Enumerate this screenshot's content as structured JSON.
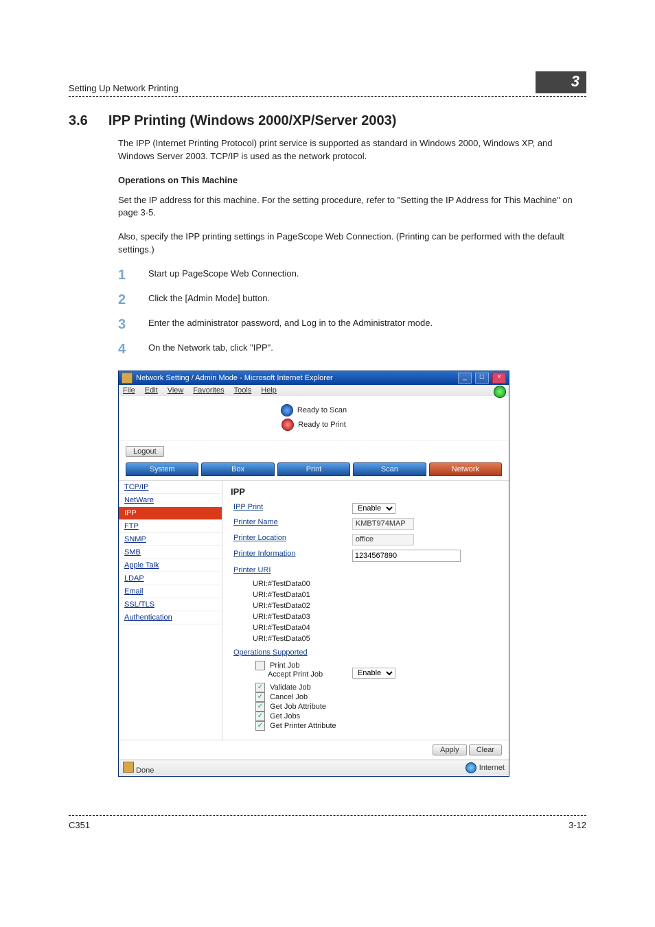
{
  "header": {
    "running_head": "Setting Up Network Printing",
    "chapter_badge": "3"
  },
  "section": {
    "number": "3.6",
    "title": "IPP Printing (Windows 2000/XP/Server 2003)"
  },
  "intro_para": "The IPP (Internet Printing Protocol) print service is supported as standard in Windows 2000, Windows XP, and Windows Server 2003. TCP/IP is used as the network protocol.",
  "subhead": "Operations on This Machine",
  "ops_para1": "Set the IP address for this machine. For the setting procedure, refer to \"Setting the IP Address for This Machine\" on page 3-5.",
  "ops_para2": "Also, specify the IPP printing settings in PageScope Web Connection. (Printing can be performed with the default settings.)",
  "steps": [
    "Start up PageScope Web Connection.",
    "Click the [Admin Mode] button.",
    "Enter the administrator password, and Log in to the Administrator mode.",
    "On the Network tab, click \"IPP\"."
  ],
  "browser": {
    "titlebar_text": "Network Setting / Admin Mode - Microsoft Internet Explorer",
    "menus": [
      "File",
      "Edit",
      "View",
      "Favorites",
      "Tools",
      "Help"
    ],
    "status_ready_scan": "Ready to Scan",
    "status_ready_print": "Ready to Print",
    "logout_btn": "Logout",
    "tabs": [
      "System",
      "Box",
      "Print",
      "Scan",
      "Network"
    ],
    "sidebar_items": [
      "TCP/IP",
      "NetWare",
      "IPP",
      "FTP",
      "SNMP",
      "SMB",
      "Apple Talk",
      "LDAP",
      "Email",
      "SSL/TLS",
      "Authentication"
    ],
    "panel": {
      "heading": "IPP",
      "ipp_print_label": "IPP Print",
      "ipp_print_value": "Enable",
      "printer_name_label": "Printer Name",
      "printer_name_value": "KMBT974MAP",
      "printer_location_label": "Printer Location",
      "printer_location_value": "office",
      "printer_information_label": "Printer Information",
      "printer_information_value": "1234567890",
      "printer_uri_label": "Printer URI",
      "uris": [
        "URI:#TestData00",
        "URI:#TestData01",
        "URI:#TestData02",
        "URI:#TestData03",
        "URI:#TestData04",
        "URI:#TestData05"
      ],
      "ops_supported_label": "Operations Supported",
      "ops": [
        {
          "label": "Print Job",
          "checked": false
        },
        {
          "label": "Accept Print Job",
          "checked": false,
          "right_label": "Enable"
        },
        {
          "label": "Validate Job",
          "checked": true
        },
        {
          "label": "Cancel Job",
          "checked": true
        },
        {
          "label": "Get Job Attribute",
          "checked": true
        },
        {
          "label": "Get Jobs",
          "checked": true
        },
        {
          "label": "Get Printer Attribute",
          "checked": true
        }
      ],
      "apply_btn": "Apply",
      "clear_btn": "Clear"
    },
    "statusbar": {
      "left": "Done",
      "right": "Internet"
    }
  },
  "footer": {
    "left": "C351",
    "right": "3-12"
  }
}
